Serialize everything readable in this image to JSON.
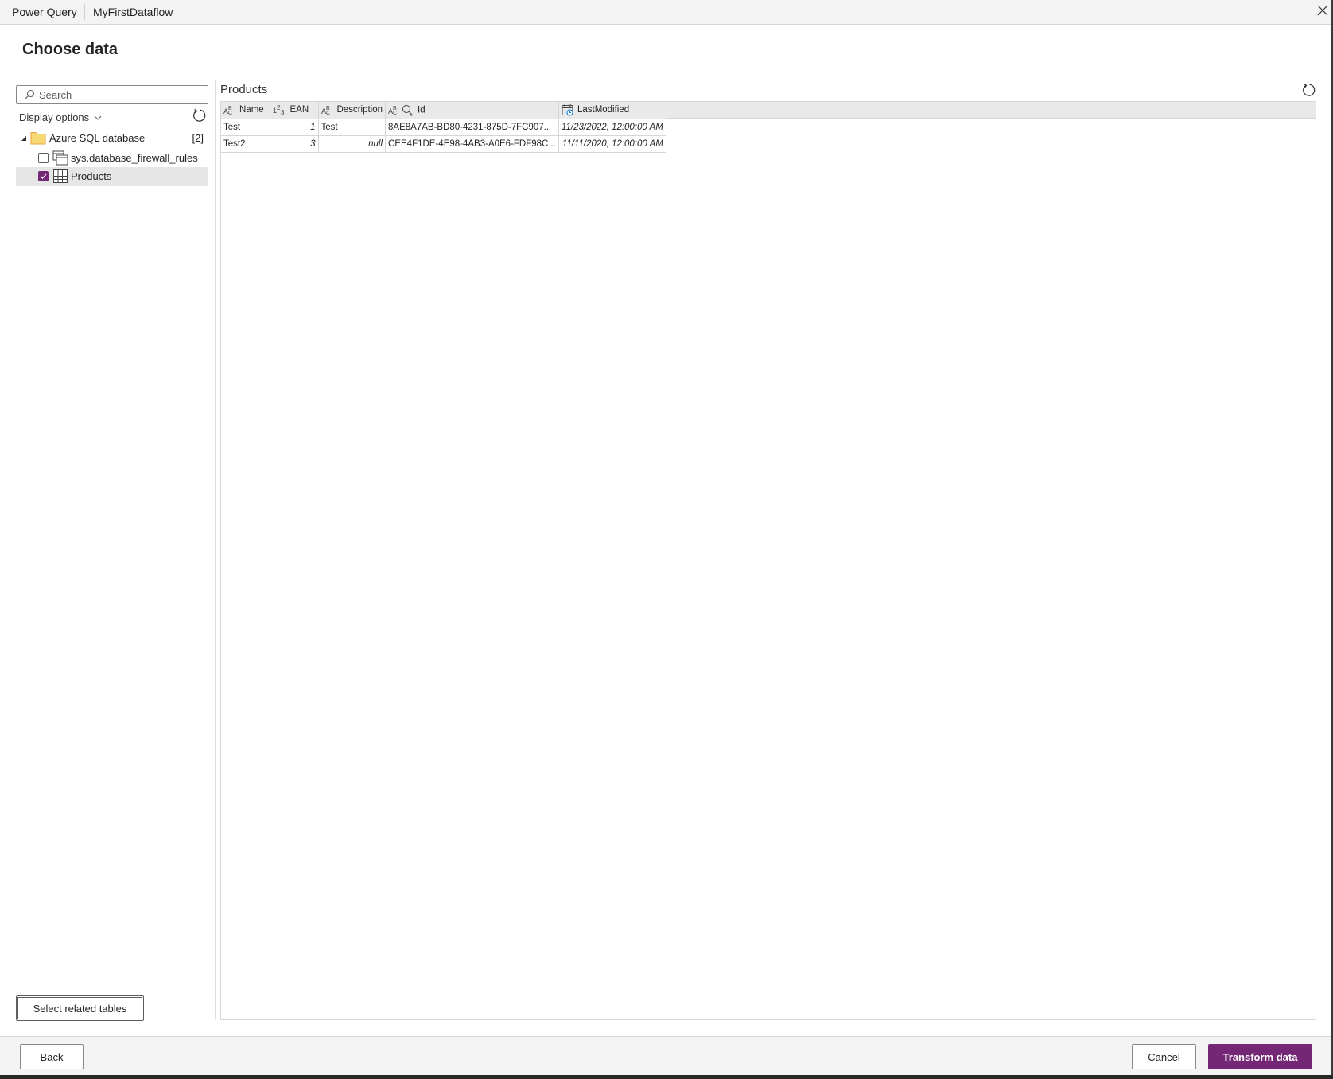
{
  "titlebar": {
    "app_name": "Power Query",
    "document_name": "MyFirstDataflow",
    "close_icon": "close-icon"
  },
  "page": {
    "title": "Choose data"
  },
  "navigator": {
    "search_placeholder": "Search",
    "search_value": "",
    "display_options_label": "Display options",
    "tree": {
      "source": {
        "label": "Azure SQL database",
        "count": "[2]",
        "expanded": true,
        "icon": "folder-icon"
      },
      "items": [
        {
          "label": "sys.database_firewall_rules",
          "checked": false,
          "icon": "view-icon"
        },
        {
          "label": "Products",
          "checked": true,
          "selected": true,
          "icon": "table-icon"
        }
      ]
    },
    "select_related_label": "Select related tables"
  },
  "preview": {
    "title": "Products",
    "columns": [
      {
        "name": "Name",
        "type_icon": "text-type-icon"
      },
      {
        "name": "EAN",
        "type_icon": "number-type-icon"
      },
      {
        "name": "Description",
        "type_icon": "text-type-icon"
      },
      {
        "name": "Id",
        "type_icon": "text-type-icon",
        "key_icon": "key-icon"
      },
      {
        "name": "LastModified",
        "type_icon": "datetime-type-icon"
      }
    ],
    "rows": [
      [
        "Test",
        "1",
        "Test",
        "8AE8A7AB-BD80-4231-875D-7FC907...",
        "11/23/2022, 12:00:00 AM"
      ],
      [
        "Test2",
        "3",
        "null",
        "CEE4F1DE-4E98-4AB3-A0E6-FDF98C...",
        "11/11/2020, 12:00:00 AM"
      ]
    ]
  },
  "footer": {
    "back_label": "Back",
    "cancel_label": "Cancel",
    "transform_label": "Transform data"
  },
  "colors": {
    "accent": "#742774",
    "selected_row": "#e6e6e6",
    "header_band": "#e9e9e9",
    "folder": "#f8d775"
  }
}
